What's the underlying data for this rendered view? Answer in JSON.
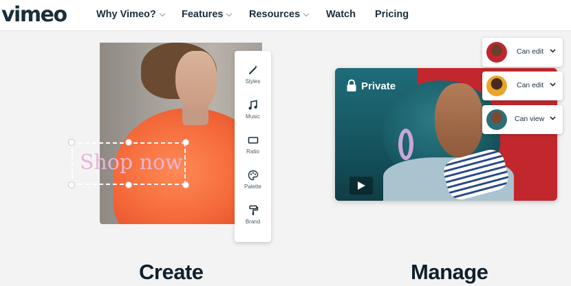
{
  "brand": {
    "logo_text": "vimeo"
  },
  "nav": {
    "items": [
      {
        "label": "Why Vimeo?",
        "dropdown": true
      },
      {
        "label": "Features",
        "dropdown": true
      },
      {
        "label": "Resources",
        "dropdown": true
      },
      {
        "label": "Watch",
        "dropdown": false
      },
      {
        "label": "Pricing",
        "dropdown": false
      }
    ]
  },
  "create": {
    "heading": "Create",
    "overlay_text": "Shop now",
    "tools": [
      {
        "label": "Styles",
        "icon": "magic-wand-icon"
      },
      {
        "label": "Music",
        "icon": "music-note-icon"
      },
      {
        "label": "Ratio",
        "icon": "aspect-ratio-icon"
      },
      {
        "label": "Palette",
        "icon": "palette-icon"
      },
      {
        "label": "Brand",
        "icon": "paint-roller-icon"
      }
    ]
  },
  "manage": {
    "heading": "Manage",
    "privacy_label": "Private",
    "permissions": [
      {
        "label": "Can edit",
        "avatar_color": "#c0272d"
      },
      {
        "label": "Can edit",
        "avatar_color": "#e8a52a"
      },
      {
        "label": "Can view",
        "avatar_color": "#2c6e78"
      }
    ]
  },
  "colors": {
    "brand_dark": "#1a2e3b",
    "accent_red": "#c2272e",
    "overlay_pink": "#e8b6d6"
  }
}
